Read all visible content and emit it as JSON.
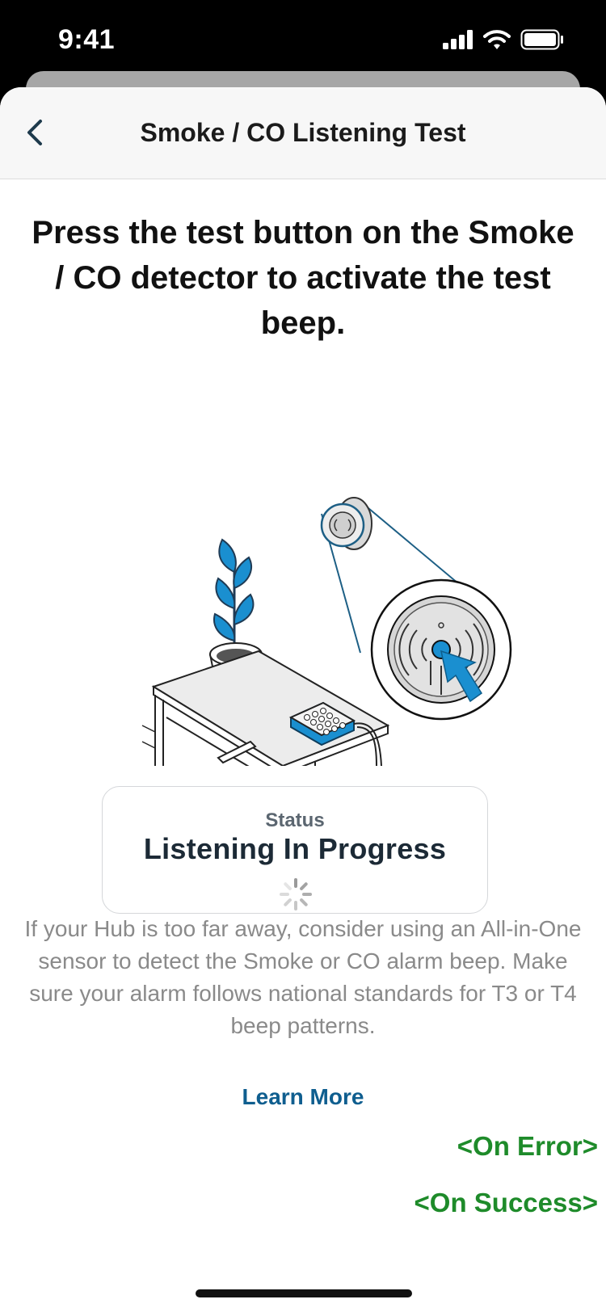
{
  "status_bar": {
    "time": "9:41"
  },
  "nav": {
    "title": "Smoke / CO Listening Test"
  },
  "headline": "Press the test button on the Smoke / CO detector to activate the test beep.",
  "status_card": {
    "label": "Status",
    "value": "Listening In Progress"
  },
  "info": {
    "text": "If your Hub is too far away, consider using an All-in-One sensor to detect the Smoke or CO alarm beep. Make sure your alarm follows national standards for T3 or T4 beep patterns.",
    "learn_more": "Learn More"
  },
  "links": {
    "on_error": "<On Error>",
    "on_success": "<On Success>"
  },
  "colors": {
    "accent_blue": "#1a8fd0",
    "link_blue": "#0f5e8f",
    "debug_green": "#1e8b2a"
  }
}
